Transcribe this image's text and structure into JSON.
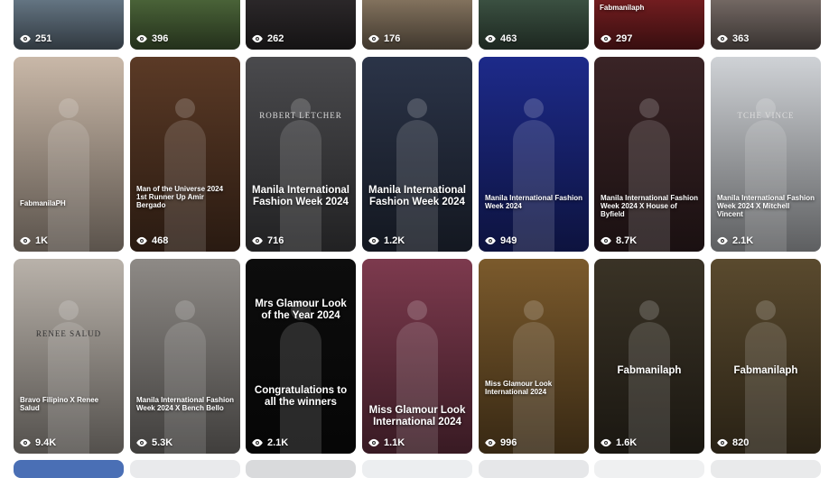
{
  "row1": [
    {
      "views": "251",
      "bg": "#6b7d8c"
    },
    {
      "views": "396",
      "bg": "#4f6a3c"
    },
    {
      "views": "262",
      "bg": "#2e2a2c"
    },
    {
      "views": "176",
      "bg": "#8c7a64"
    },
    {
      "views": "463",
      "bg": "#3f5646"
    },
    {
      "views": "297",
      "bg": "#7a1f22",
      "caption": "Fabmanilaph"
    },
    {
      "views": "363",
      "bg": "#7b6f6a"
    }
  ],
  "row2": [
    {
      "views": "1K",
      "bg": "#c9b8a8",
      "caption": "FabmanilaPH",
      "style": "small"
    },
    {
      "views": "468",
      "bg": "#5b3a26",
      "caption": "Man of the Universe 2024 1st Runner Up Amir Bergado",
      "style": "small"
    },
    {
      "views": "716",
      "bg": "#4a4a4d",
      "caption": "Manila International Fashion Week 2024",
      "style": "big",
      "banner": "ROBERT LETCHER"
    },
    {
      "views": "1.2K",
      "bg": "#2b3448",
      "caption": "Manila International Fashion Week 2024",
      "style": "big"
    },
    {
      "views": "949",
      "bg": "#1d2a8a",
      "caption": "Manila International Fashion Week 2024",
      "style": "small"
    },
    {
      "views": "8.7K",
      "bg": "#3a2426",
      "caption": "Manila International Fashion Week 2024 X House of Byfield",
      "style": "small"
    },
    {
      "views": "2.1K",
      "bg": "#cfd2d6",
      "caption": "Manila International Fashion Week 2024 X Mitchell Vincent",
      "style": "small",
      "banner": "TCHE VINCE"
    }
  ],
  "row3": [
    {
      "views": "9.4K",
      "bg": "#b9b2aa",
      "caption": "Bravo Filipino X Renee Salud",
      "style": "small",
      "banner": "RENEE SALUD"
    },
    {
      "views": "5.3K",
      "bg": "#8e8a86",
      "caption": "Manila International Fashion Week 2024 X Bench Bello",
      "style": "small"
    },
    {
      "views": "2.1K",
      "bg": "#0d0d0d",
      "caption_top": "Mrs Glamour Look of the Year 2024",
      "caption": "Congratulations to all the winners",
      "style": "big"
    },
    {
      "views": "1.1K",
      "bg": "#7d3a4e",
      "caption": "Miss Glamour Look International 2024",
      "style": "big"
    },
    {
      "views": "996",
      "bg": "#7b5a2c",
      "caption": "Miss Glamour Look International 2024",
      "style": "small"
    },
    {
      "views": "1.6K",
      "bg": "#3a3326",
      "caption": "Fabmanilaph",
      "style": "big"
    },
    {
      "views": "820",
      "bg": "#5a4a2e",
      "caption": "Fabmanilaph",
      "style": "big"
    }
  ]
}
